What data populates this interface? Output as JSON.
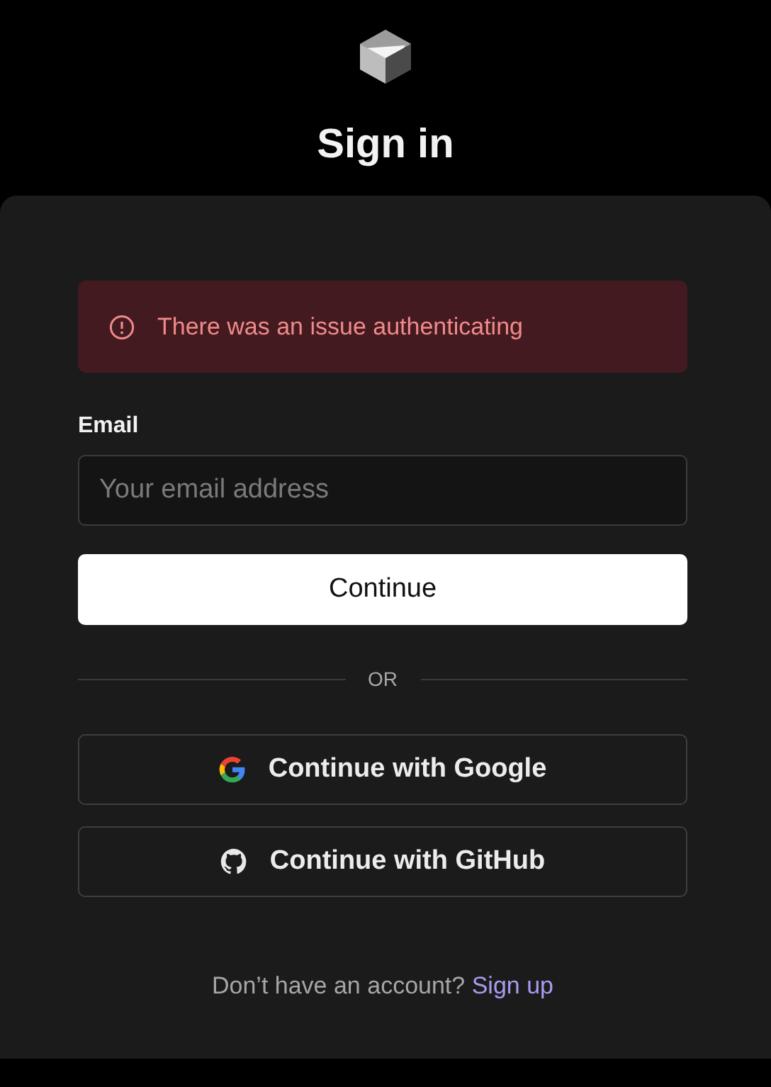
{
  "header": {
    "title": "Sign in"
  },
  "alert": {
    "message": "There was an issue authenticating"
  },
  "email": {
    "label": "Email",
    "placeholder": "Your email address"
  },
  "submit": {
    "label": "Continue"
  },
  "divider": {
    "label": "OR"
  },
  "providers": [
    {
      "kind": "google",
      "label": "Continue with Google"
    },
    {
      "kind": "github",
      "label": "Continue with GitHub"
    }
  ],
  "footer": {
    "prompt": "Don’t have an account?",
    "link": "Sign up"
  }
}
